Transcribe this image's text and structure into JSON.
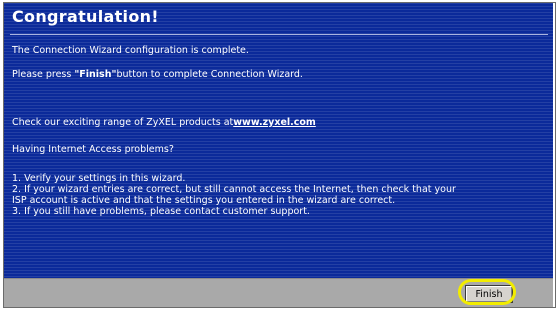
{
  "wizard": {
    "title": "Congratulation!",
    "complete_message": "The Connection Wizard configuration is complete.",
    "press_prefix": "Please press ",
    "press_button_name": "\"Finish\"",
    "press_suffix": "button to complete Connection Wizard.",
    "check_prefix": "Check our exciting range of ZyXEL products at",
    "website_link": "www.zyxel.com",
    "problems_heading": "Having Internet Access problems?",
    "steps": [
      "1. Verify your settings in this wizard.",
      "2. If your wizard entries are correct, but still cannot access the Internet, then check that your",
      "ISP account is active and that the settings you entered in the wizard are correct.",
      "3. If you still have problems, please contact customer support."
    ]
  },
  "footer": {
    "finish_label": "Finish"
  },
  "colors": {
    "panel_blue": "#0b2a9a",
    "footer_gray": "#a9a9a9",
    "highlight_yellow": "#f2ec00"
  }
}
